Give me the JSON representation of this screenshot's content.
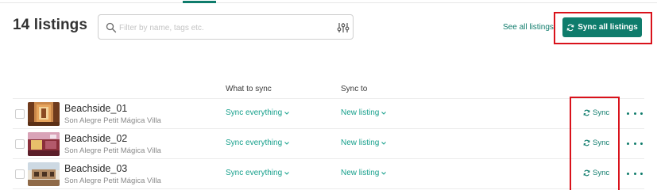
{
  "header": {
    "title": "14 listings",
    "search_placeholder": "Filter by name, tags etc.",
    "see_all_label": "See all listings",
    "sync_all_label": "Sync all listings"
  },
  "columns": {
    "what_to_sync": "What to sync",
    "sync_to": "Sync to"
  },
  "listings": [
    {
      "name": "Beachside_01",
      "subtitle": "Son Alegre Petit Mágica Villa",
      "what_to_sync": "Sync everything",
      "sync_to": "New listing",
      "sync_label": "Sync"
    },
    {
      "name": "Beachside_02",
      "subtitle": "Son Alegre Petit Mágica Villa",
      "what_to_sync": "Sync everything",
      "sync_to": "New listing",
      "sync_label": "Sync"
    },
    {
      "name": "Beachside_03",
      "subtitle": "Son Alegre Petit Mágica Villa",
      "what_to_sync": "Sync everything",
      "sync_to": "New listing",
      "sync_label": "Sync"
    }
  ],
  "icons": {
    "search": "search-icon",
    "filter": "filter-sliders-icon",
    "sync": "sync-icon",
    "chevron": "chevron-down-icon",
    "more": "more-horizontal-icon"
  },
  "colors": {
    "accent": "#0f7c6c",
    "link": "#17a08c",
    "highlight_frame": "#d9121b"
  }
}
